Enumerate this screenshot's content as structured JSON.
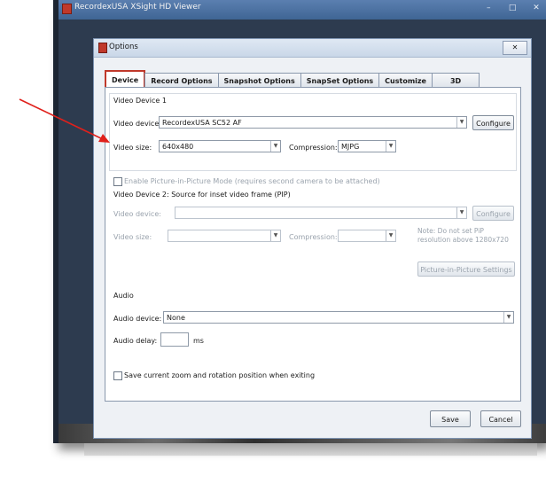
{
  "app_window": {
    "title": "RecordexUSA XSight HD Viewer",
    "controls": [
      "–",
      "□",
      "✕"
    ]
  },
  "dialog": {
    "title": "Options",
    "close_label": "✕",
    "tabs": [
      {
        "label": "Device",
        "active": true
      },
      {
        "label": "Record Options",
        "active": false
      },
      {
        "label": "Snapshot Options",
        "active": false
      },
      {
        "label": "SnapSet Options",
        "active": false
      },
      {
        "label": "Customize",
        "active": false
      },
      {
        "label": "3D",
        "active": false
      }
    ],
    "device1": {
      "heading": "Video Device 1",
      "video_device_label": "Video device:",
      "video_device_value": "RecordexUSA SC52 AF",
      "configure_label": "Configure",
      "video_size_label": "Video size:",
      "video_size_value": "640x480",
      "compression_label": "Compression:",
      "compression_value": "MJPG"
    },
    "pip": {
      "enable_label": "Enable Picture-in-Picture Mode (requires second camera to be attached)",
      "enable_checked": false,
      "heading": "Video Device 2: Source for inset video frame (PIP)",
      "video_device_label": "Video device:",
      "video_device_value": "",
      "configure_label": "Configure",
      "video_size_label": "Video size:",
      "video_size_value": "",
      "compression_label": "Compression:",
      "compression_value": "",
      "note": "Note: Do not set PiP resolution above 1280x720",
      "settings_button": "Picture-in-Picture Settings"
    },
    "audio": {
      "heading": "Audio",
      "device_label": "Audio device:",
      "device_value": "None",
      "delay_label": "Audio delay:",
      "delay_value": "",
      "delay_unit": "ms"
    },
    "save_zoom": {
      "label": "Save current zoom and rotation position when exiting",
      "checked": false
    },
    "buttons": {
      "save": "Save",
      "cancel": "Cancel"
    }
  },
  "colors": {
    "arrow": "#e0201b",
    "active_tab_border": "#c0392b",
    "window_frame": "#2d3b4f"
  }
}
